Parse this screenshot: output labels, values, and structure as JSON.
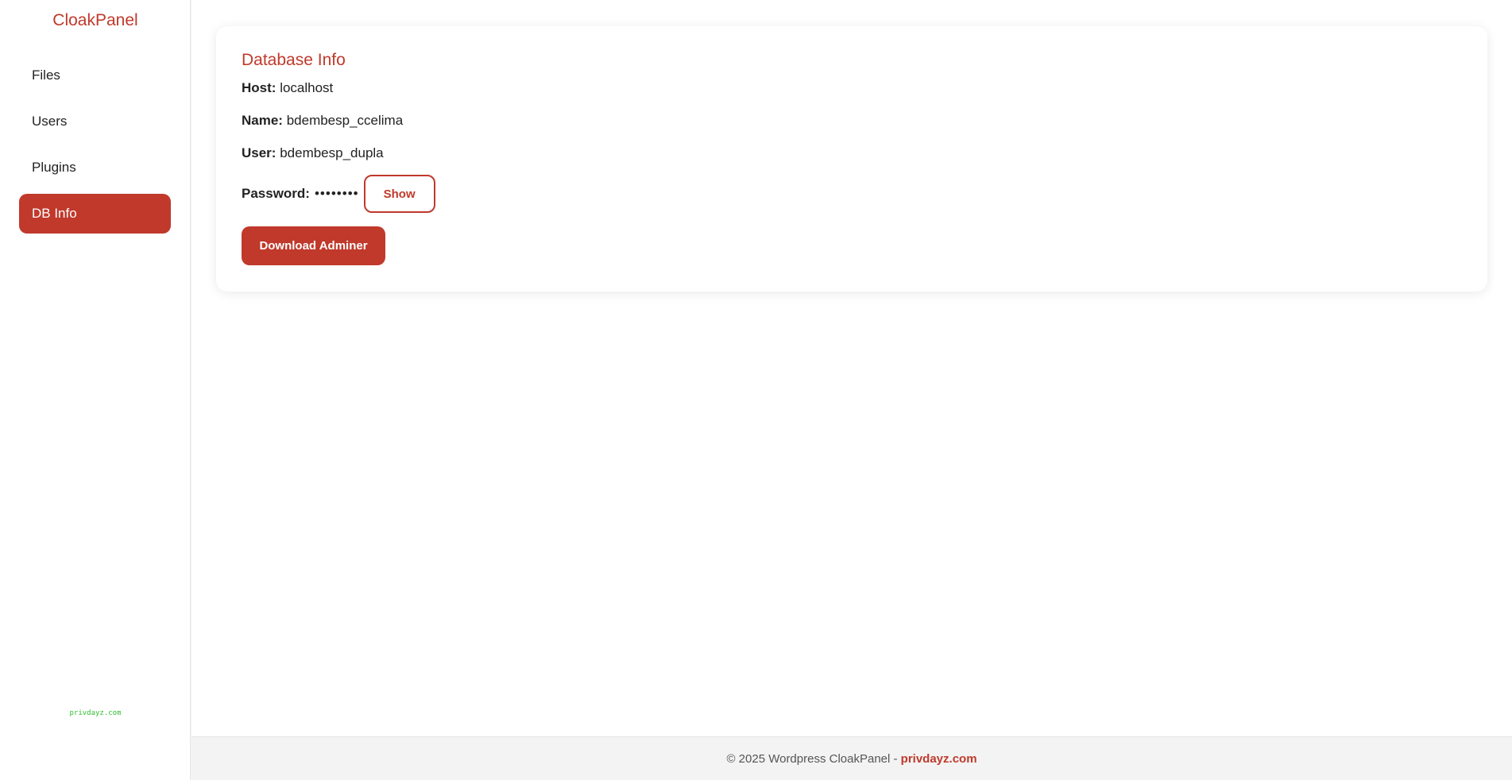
{
  "sidebar": {
    "brand": "CloakPanel",
    "items": [
      {
        "label": "Files"
      },
      {
        "label": "Users"
      },
      {
        "label": "Plugins"
      },
      {
        "label": "DB Info"
      }
    ],
    "footer_text": "privdayz.com"
  },
  "db_info": {
    "title": "Database Info",
    "host_label": "Host:",
    "host_value": "localhost",
    "name_label": "Name:",
    "name_value": "bdembesp_ccelima",
    "user_label": "User:",
    "user_value": "bdembesp_dupla",
    "password_label": "Password:",
    "password_masked": "••••••••",
    "show_button": "Show",
    "download_button": "Download Adminer"
  },
  "footer": {
    "text": "© 2025 Wordpress CloakPanel - ",
    "link": "privdayz.com"
  },
  "colors": {
    "accent": "#c0392b",
    "sidebar_footer": "#2fbf2f"
  }
}
